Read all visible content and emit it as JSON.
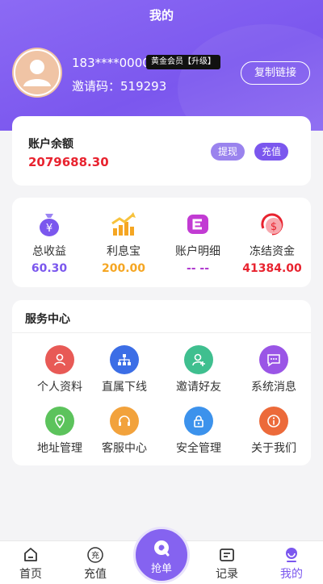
{
  "page": {
    "title": "我的"
  },
  "user": {
    "phone": "183****0000",
    "level_badge": "黄金会员【升级】",
    "invite_code": "邀请码：519293",
    "copy_link": "复制链接"
  },
  "balance": {
    "label": "账户余额",
    "value": "2079688.30",
    "withdraw": "提现",
    "recharge": "充值"
  },
  "stats": [
    {
      "label": "总收益",
      "value": "60.30",
      "icon": "money-bag-icon",
      "color": "#7b57ee"
    },
    {
      "label": "利息宝",
      "value": "200.00",
      "icon": "growth-chart-icon",
      "color": "#f5a623"
    },
    {
      "label": "账户明细",
      "value": "-- --",
      "icon": "wallet-e-icon",
      "color": "#b03ccf"
    },
    {
      "label": "冻结资金",
      "value": "41384.00",
      "icon": "frozen-dollar-icon",
      "color": "#e8232f"
    }
  ],
  "services": {
    "title": "服务中心",
    "items": [
      {
        "label": "个人资料",
        "icon": "user-icon",
        "color": "#e85a56"
      },
      {
        "label": "直属下线",
        "icon": "org-chart-icon",
        "color": "#3c6ee6"
      },
      {
        "label": "邀请好友",
        "icon": "add-user-icon",
        "color": "#3fbf8f"
      },
      {
        "label": "系统消息",
        "icon": "message-icon",
        "color": "#9a55e6"
      },
      {
        "label": "地址管理",
        "icon": "location-icon",
        "color": "#5cc35c"
      },
      {
        "label": "客服中心",
        "icon": "headset-icon",
        "color": "#f2a23c"
      },
      {
        "label": "安全管理",
        "icon": "lock-icon",
        "color": "#3c92ec"
      },
      {
        "label": "关于我们",
        "icon": "info-icon",
        "color": "#ec6a3a"
      }
    ]
  },
  "tabbar": {
    "home": "首页",
    "recharge": "充值",
    "recharge_glyph": "充",
    "grab": "抢单",
    "records": "记录",
    "mine": "我的",
    "active_color": "#7b57ee"
  }
}
